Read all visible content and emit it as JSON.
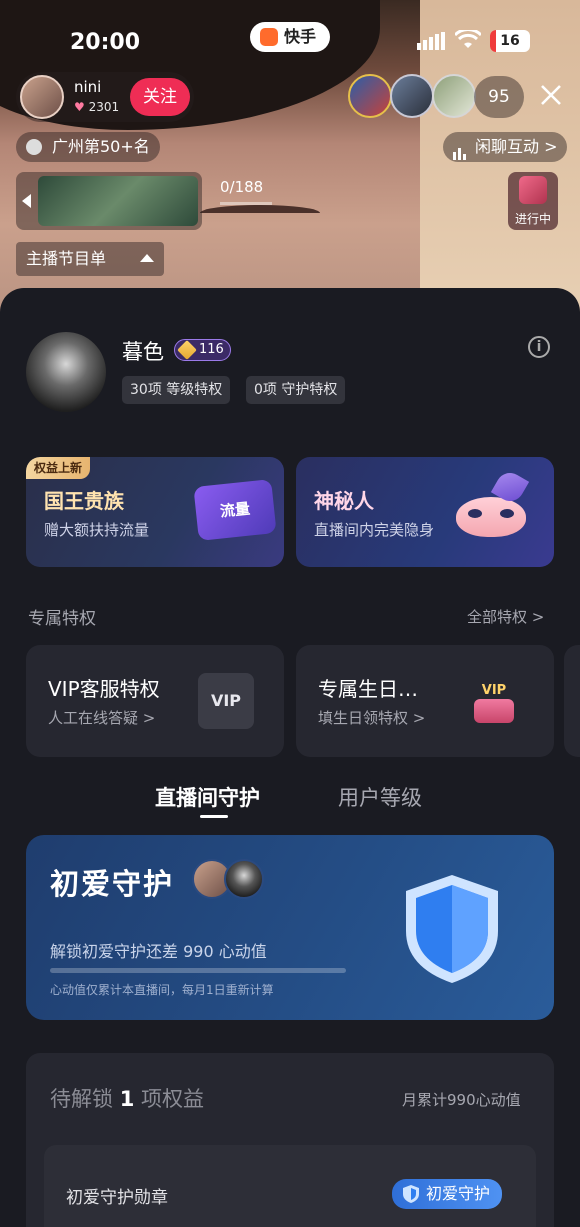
{
  "status_bar": {
    "time": "20:00",
    "app_badge": "快手",
    "battery": "16"
  },
  "streamer": {
    "name": "nini",
    "likes": "2301",
    "follow_label": "关注"
  },
  "viewers": {
    "count": "95"
  },
  "rank": {
    "label": "广州第50+名"
  },
  "chat_mode": {
    "label": "闲聊互动 >"
  },
  "banner": {
    "progress": "0/188"
  },
  "ongoing": {
    "label": "进行中"
  },
  "schedule": {
    "label": "主播节目单"
  },
  "profile": {
    "name": "暮色",
    "level": "116",
    "level_perks": "30项 等级特权",
    "guard_perks": "0项 守护特权"
  },
  "promo_cards": [
    {
      "corner_tag": "权益上新",
      "title": "国王贵族",
      "subtitle": "赠大额扶持流量",
      "art_text": "流量"
    },
    {
      "title": "神秘人",
      "subtitle": "直播间内完美隐身"
    }
  ],
  "exclusive": {
    "heading": "专属特权",
    "all_link": "全部特权 >"
  },
  "perk_cards": [
    {
      "title": "VIP客服特权",
      "subtitle": "人工在线答疑 >",
      "icon_text": "VIP"
    },
    {
      "title": "专属生日…",
      "subtitle": "填生日领特权 >",
      "icon_text": "VIP"
    }
  ],
  "tabs": [
    {
      "label": "直播间守护",
      "active": true
    },
    {
      "label": "用户等级",
      "active": false
    }
  ],
  "guard": {
    "title": "初爱守护",
    "unlock_text": "解锁初爱守护还差 990 心动值",
    "note": "心动值仅累计本直播间，每月1日重新计算",
    "progress": 0
  },
  "pending": {
    "label_prefix": "待解锁",
    "count": "1",
    "label_suffix": "项权益",
    "monthly": "月累计990心动值",
    "item_label": "初爱守护勋章",
    "item_badge": "初爱守护"
  },
  "colors": {
    "follow": "#ef2d55",
    "accent_blue": "#3a7ef0",
    "sheet_bg": "#1a1b22"
  }
}
